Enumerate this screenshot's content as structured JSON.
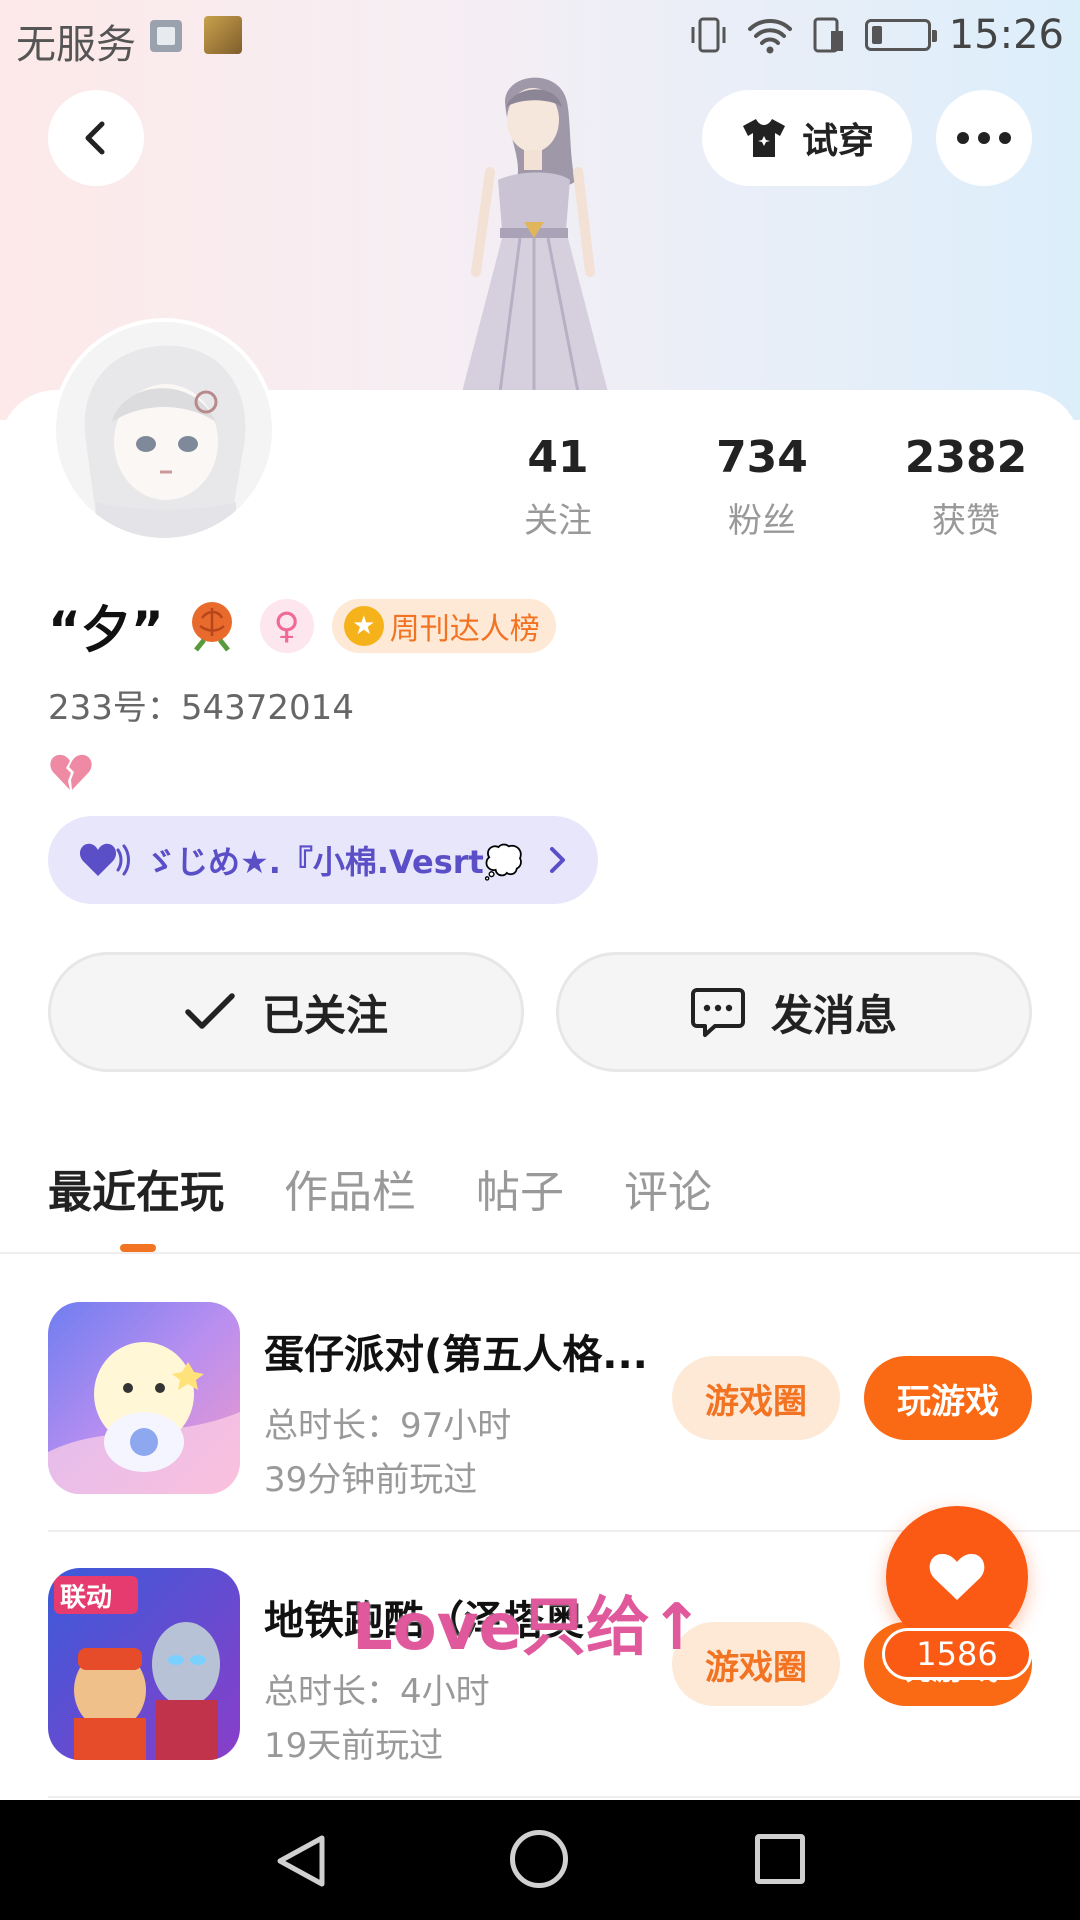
{
  "status_bar": {
    "carrier": "无服务",
    "time": "15:26"
  },
  "header": {
    "tryon_label": "试穿"
  },
  "profile": {
    "name": "“夕”",
    "rank_badge": "周刊达人榜",
    "id_line": "233号：54372014",
    "family_text": "ゞじめ★.『小棉.Vesrt💭"
  },
  "stats": [
    {
      "value": "41",
      "label": "关注"
    },
    {
      "value": "734",
      "label": "粉丝"
    },
    {
      "value": "2382",
      "label": "获赞"
    }
  ],
  "actions": {
    "follow_label": "已关注",
    "message_label": "发消息"
  },
  "tabs": [
    {
      "label": "最近在玩",
      "active": true
    },
    {
      "label": "作品栏",
      "active": false
    },
    {
      "label": "帖子",
      "active": false
    },
    {
      "label": "评论",
      "active": false
    }
  ],
  "games": [
    {
      "title": "蛋仔派对(第五人格...",
      "duration": "总时长：97小时",
      "last_played": "39分钟前玩过",
      "circle_label": "游戏圈",
      "play_label": "玩游戏"
    },
    {
      "title": "地铁跑酷（泽塔奥",
      "duration": "总时长：4小时",
      "last_played": "19天前玩过",
      "circle_label": "游戏圈",
      "play_label": "玩游戏"
    }
  ],
  "overlay": {
    "text": "Love只给↑"
  },
  "like": {
    "count": "1586"
  },
  "colors": {
    "accent": "#fa6a14",
    "accent_light": "#fde9d6",
    "family_pill_bg": "#e8e6fb",
    "family_pill_text": "#5a4fc7"
  },
  "icons": [
    "back-arrow-icon",
    "tshirt-icon",
    "more-dots-icon",
    "female-icon",
    "star-coin-icon",
    "broken-heart-icon",
    "double-heart-icon",
    "chevron-right-icon",
    "check-icon",
    "chat-bubble-icon",
    "heart-icon",
    "nav-back-icon",
    "nav-home-icon",
    "nav-recent-icon"
  ]
}
